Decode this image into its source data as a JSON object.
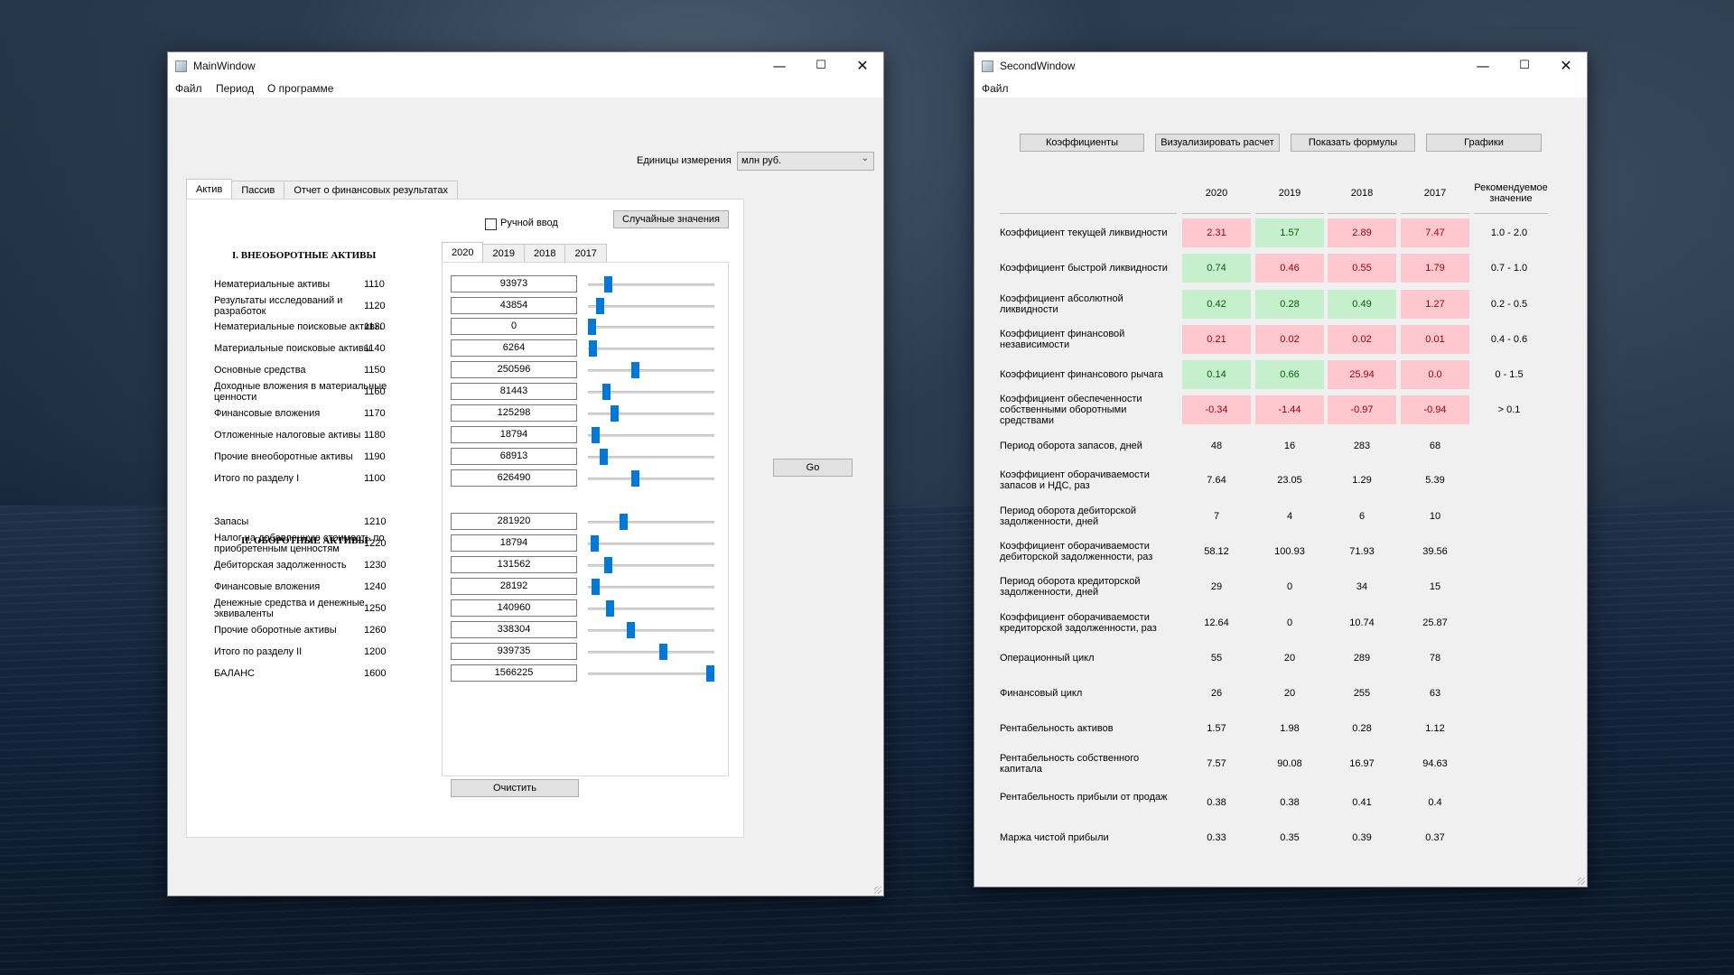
{
  "main_window": {
    "title": "MainWindow",
    "menu": [
      "Файл",
      "Период",
      "О программе"
    ],
    "units_label": "Единицы измерения",
    "units_value": "млн руб.",
    "tabs": [
      "Актив",
      "Пассив",
      "Отчет о финансовых результатах"
    ],
    "manual_input_label": "Ручной ввод",
    "manual_input_checked": false,
    "random_button": "Случайные значения",
    "year_tabs": [
      "2020",
      "2019",
      "2018",
      "2017"
    ],
    "active_year": "2020",
    "section1_title": "I. ВНЕОБОРОТНЫЕ АКТИВЫ",
    "section2_title": "II. ОБОРОТНЫЕ АКТИВЫ",
    "section1_rows": [
      {
        "label": "Нематериальные активы",
        "code": "1110",
        "value": "93973",
        "slider": 0.14
      },
      {
        "label": "Результаты исследований и разработок",
        "code": "1120",
        "value": "43854",
        "slider": 0.07
      },
      {
        "label": "Нематериальные поисковые активы",
        "code": "1130",
        "value": "0",
        "slider": 0.0
      },
      {
        "label": "Материальные поисковые активы",
        "code": "1140",
        "value": "6264",
        "slider": 0.01
      },
      {
        "label": "Основные средства",
        "code": "1150",
        "value": "250596",
        "slider": 0.37
      },
      {
        "label": "Доходные вложения в материальные ценности",
        "code": "1160",
        "value": "81443",
        "slider": 0.12
      },
      {
        "label": "Финансовые вложения",
        "code": "1170",
        "value": "125298",
        "slider": 0.19
      },
      {
        "label": "Отложенные налоговые активы",
        "code": "1180",
        "value": "18794",
        "slider": 0.03
      },
      {
        "label": "Прочие внеоборотные активы",
        "code": "1190",
        "value": "68913",
        "slider": 0.1
      },
      {
        "label": "Итого по разделу I",
        "code": "1100",
        "value": "626490",
        "slider": 0.37
      }
    ],
    "section2_rows": [
      {
        "label": "Запасы",
        "code": "1210",
        "value": "281920",
        "slider": 0.27
      },
      {
        "label": "Налог на добавленную стоимость по приобретенным ценностям",
        "code": "1220",
        "value": "18794",
        "slider": 0.02
      },
      {
        "label": "Дебиторская задолженность",
        "code": "1230",
        "value": "131562",
        "slider": 0.14
      },
      {
        "label": "Финансовые вложения",
        "code": "1240",
        "value": "28192",
        "slider": 0.03
      },
      {
        "label": "Денежные средства и денежные эквиваленты",
        "code": "1250",
        "value": "140960",
        "slider": 0.15
      },
      {
        "label": "Прочие оборотные активы",
        "code": "1260",
        "value": "338304",
        "slider": 0.33
      },
      {
        "label": "Итого по разделу II",
        "code": "1200",
        "value": "939735",
        "slider": 0.6
      },
      {
        "label": "БАЛАНС",
        "code": "1600",
        "value": "1566225",
        "slider": 1.0
      }
    ],
    "clear_button": "Очистить",
    "go_button": "Go"
  },
  "second_window": {
    "title": "SecondWindow",
    "menu": [
      "Файл"
    ],
    "buttons": [
      "Коэффициенты",
      "Визуализировать расчет",
      "Показать формулы",
      "Графики"
    ],
    "col_headers": [
      "2020",
      "2019",
      "2018",
      "2017"
    ],
    "rec_header": "Рекомендуемое значение",
    "colors": {
      "good_bg": "#c6efce",
      "good_fg": "#006100",
      "bad_bg": "#ffc7ce",
      "bad_fg": "#9c0006"
    },
    "rows": [
      {
        "label": "Коэффициент текущей ликвидности",
        "values": [
          "2.31",
          "1.57",
          "2.89",
          "7.47"
        ],
        "status": [
          "bad",
          "good",
          "bad",
          "bad"
        ],
        "rec": "1.0 - 2.0"
      },
      {
        "label": "Коэффициент быстрой ликвидности",
        "values": [
          "0.74",
          "0.46",
          "0.55",
          "1.79"
        ],
        "status": [
          "good",
          "bad",
          "bad",
          "bad"
        ],
        "rec": "0.7 - 1.0"
      },
      {
        "label": "Коэффициент абсолютной ликвидности",
        "values": [
          "0.42",
          "0.28",
          "0.49",
          "1.27"
        ],
        "status": [
          "good",
          "good",
          "good",
          "bad"
        ],
        "rec": "0.2 - 0.5"
      },
      {
        "label": "Коэффициент финансовой независимости",
        "values": [
          "0.21",
          "0.02",
          "0.02",
          "0.01"
        ],
        "status": [
          "bad",
          "bad",
          "bad",
          "bad"
        ],
        "rec": "0.4 - 0.6"
      },
      {
        "label": "Коэффициент финансового рычага",
        "values": [
          "0.14",
          "0.66",
          "25.94",
          "0.0"
        ],
        "status": [
          "good",
          "good",
          "bad",
          "bad"
        ],
        "rec": "0 - 1.5"
      },
      {
        "label": "Коэффициент обеспеченности собственными оборотными средствами",
        "values": [
          "-0.34",
          "-1.44",
          "-0.97",
          "-0.94"
        ],
        "status": [
          "bad",
          "bad",
          "bad",
          "bad"
        ],
        "rec": "> 0.1"
      },
      {
        "label": "Период оборота запасов, дней",
        "values": [
          "48",
          "16",
          "283",
          "68"
        ],
        "status": [
          "",
          "",
          "",
          ""
        ],
        "rec": ""
      },
      {
        "label": "Коэффициент оборачиваемости запасов и НДС, раз",
        "values": [
          "7.64",
          "23.05",
          "1.29",
          "5.39"
        ],
        "status": [
          "",
          "",
          "",
          ""
        ],
        "rec": ""
      },
      {
        "label": "Период оборота дебиторской задолженности, дней",
        "values": [
          "7",
          "4",
          "6",
          "10"
        ],
        "status": [
          "",
          "",
          "",
          ""
        ],
        "rec": ""
      },
      {
        "label": "Коэффициент оборачиваемости дебиторской задолженности, раз",
        "values": [
          "58.12",
          "100.93",
          "71.93",
          "39.56"
        ],
        "status": [
          "",
          "",
          "",
          ""
        ],
        "rec": ""
      },
      {
        "label": "Период оборота кредиторской задолженности, дней",
        "values": [
          "29",
          "0",
          "34",
          "15"
        ],
        "status": [
          "",
          "",
          "",
          ""
        ],
        "rec": ""
      },
      {
        "label": "Коэффициент оборачиваемости кредиторской задолженности, раз",
        "values": [
          "12.64",
          "0",
          "10.74",
          "25.87"
        ],
        "status": [
          "",
          "",
          "",
          ""
        ],
        "rec": ""
      },
      {
        "label": "Операционный цикл",
        "values": [
          "55",
          "20",
          "289",
          "78"
        ],
        "status": [
          "",
          "",
          "",
          ""
        ],
        "rec": ""
      },
      {
        "label": "Финансовый цикл",
        "values": [
          "26",
          "20",
          "255",
          "63"
        ],
        "status": [
          "",
          "",
          "",
          ""
        ],
        "rec": ""
      },
      {
        "label": "Рентабельность активов",
        "values": [
          "1.57",
          "1.98",
          "0.28",
          "1.12"
        ],
        "status": [
          "",
          "",
          "",
          ""
        ],
        "rec": ""
      },
      {
        "label": "Рентабельность собственного капитала",
        "values": [
          "7.57",
          "90.08",
          "16.97",
          "94.63"
        ],
        "status": [
          "",
          "",
          "",
          ""
        ],
        "rec": ""
      },
      {
        "label": "Рентабельность прибыли от продаж",
        "values": [
          "0.38",
          "0.38",
          "0.41",
          "0.4"
        ],
        "status": [
          "",
          "",
          "",
          ""
        ],
        "rec": ""
      },
      {
        "label": "Маржа чистой прибыли",
        "values": [
          "0.33",
          "0.35",
          "0.39",
          "0.37"
        ],
        "status": [
          "",
          "",
          "",
          ""
        ],
        "rec": ""
      }
    ]
  }
}
